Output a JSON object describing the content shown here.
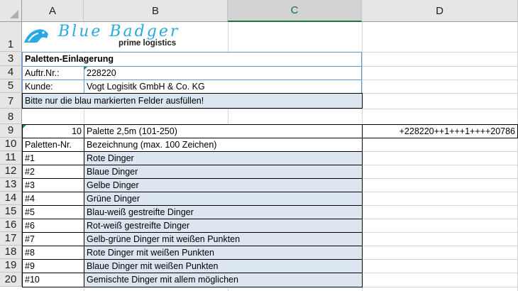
{
  "columns": [
    "A",
    "B",
    "C",
    "D"
  ],
  "rows": [
    "1",
    "3",
    "4",
    "5",
    "7",
    "8",
    "9",
    "10",
    "11",
    "12",
    "13",
    "14",
    "15",
    "16",
    "17",
    "18",
    "19",
    "20"
  ],
  "logo": {
    "brand": "Blue Badger",
    "tagline": "prime logistics"
  },
  "header": {
    "title": "Paletten-Einlagerung",
    "order_label": "Auftr.Nr.:",
    "order_value": "228220",
    "customer_label": "Kunde:",
    "customer_value": "Vogt Logisitk GmbH & Co. KG",
    "instruction": "Bitte nur die blau markierten Felder ausfüllen!"
  },
  "pallet_row": {
    "count": "10",
    "type": "Palette 2,5m (101-250)",
    "code": "+228220++1+++1++++20786"
  },
  "table": {
    "col1_header": "Paletten-Nr.",
    "col2_header": "Bezeichnung (max. 100 Zeichen)",
    "rows": [
      {
        "nr": "#1",
        "desc": "Rote Dinger"
      },
      {
        "nr": "#2",
        "desc": "Blaue Dinger"
      },
      {
        "nr": "#3",
        "desc": "Gelbe Dinger"
      },
      {
        "nr": "#4",
        "desc": "Grüne Dinger"
      },
      {
        "nr": "#5",
        "desc": "Blau-weiß gestreifte Dinger"
      },
      {
        "nr": "#6",
        "desc": "Rot-weiß gestreifte Dinger"
      },
      {
        "nr": "#7",
        "desc": "Gelb-grüne Dinger mit weißen Punkten"
      },
      {
        "nr": "#8",
        "desc": "Rote Dinger mit weißen Punkten"
      },
      {
        "nr": "#9",
        "desc": "Blaue Dinger mit weißen Punkten"
      },
      {
        "nr": "#10",
        "desc": "Gemischte Dinger mit allem möglichen"
      }
    ]
  },
  "colors": {
    "input_fill": "#dce6f1",
    "selected_header": "#217346",
    "logo_blue": "#29a9e1"
  }
}
